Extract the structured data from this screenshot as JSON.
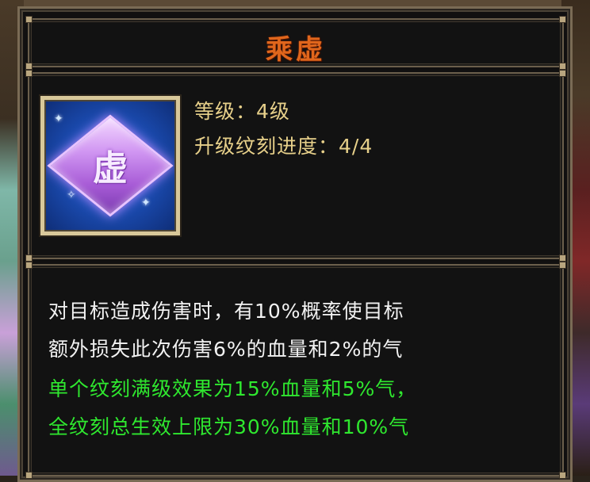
{
  "tooltip": {
    "title": "乘虚",
    "icon": {
      "name": "inscription-gem-icon",
      "glyph": "虚",
      "color": "#c58be8"
    },
    "stats": {
      "level": "等级：4级",
      "upgrade_progress": "升级纹刻进度：4/4"
    },
    "description": {
      "lines": [
        "对目标造成伤害时，有10%概率使目标",
        "额外损失此次伤害6%的血量和2%的气"
      ],
      "green_lines": [
        "单个纹刻满级效果为15%血量和5%气，",
        "全纹刻总生效上限为30%血量和10%气"
      ]
    },
    "colors": {
      "title": "#e0661c",
      "stat_text": "#e7d08a",
      "description_text": "#f2f2f2",
      "bonus_text": "#2fe82f"
    }
  }
}
